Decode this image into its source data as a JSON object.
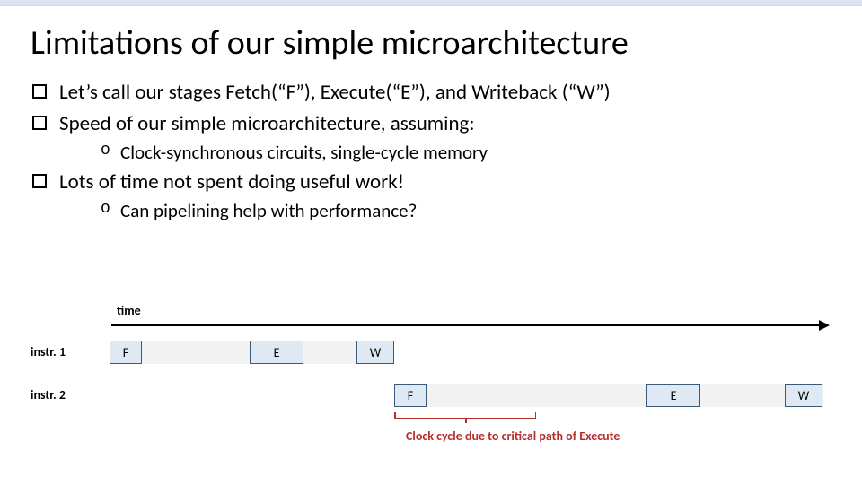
{
  "title": "Limitations of our simple microarchitecture",
  "bullets": {
    "b1": "Let’s call our stages Fetch(“F”), Execute(“E”), and Writeback (“W”)",
    "b2": "Speed of our simple microarchitecture, assuming:",
    "b2_o1": "Clock-synchronous circuits, single-cycle memory",
    "b3": "Lots of time not spent doing useful work!",
    "b3_o1": "Can pipelining help with performance?"
  },
  "diagram": {
    "time_label": "time",
    "row1_label": "instr. 1",
    "row2_label": "instr. 2",
    "stages": {
      "F": "F",
      "E": "E",
      "W": "W"
    },
    "clock_caption": "Clock cycle due to critical path of Execute"
  }
}
